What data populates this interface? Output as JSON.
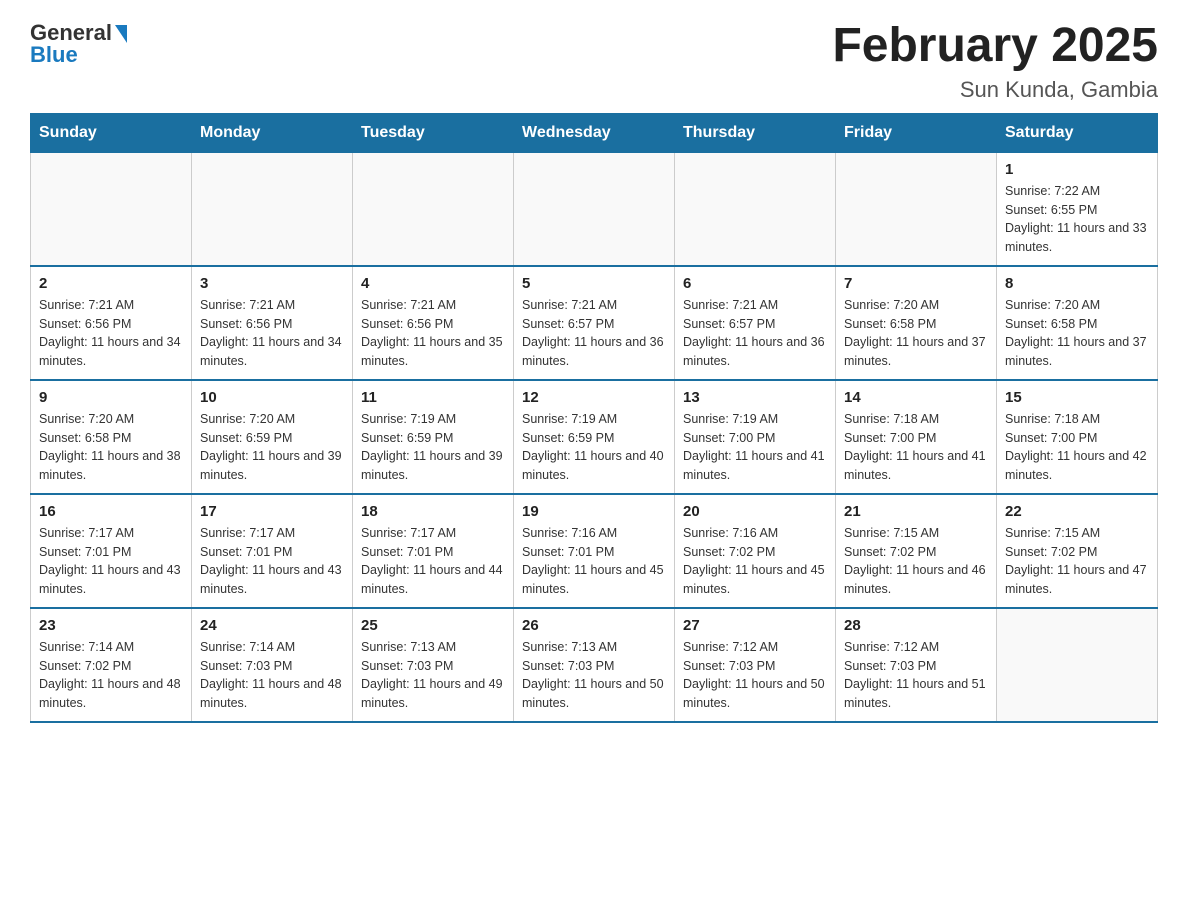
{
  "logo": {
    "general": "General",
    "blue": "Blue"
  },
  "title": "February 2025",
  "location": "Sun Kunda, Gambia",
  "weekdays": [
    "Sunday",
    "Monday",
    "Tuesday",
    "Wednesday",
    "Thursday",
    "Friday",
    "Saturday"
  ],
  "weeks": [
    [
      {
        "day": "",
        "info": ""
      },
      {
        "day": "",
        "info": ""
      },
      {
        "day": "",
        "info": ""
      },
      {
        "day": "",
        "info": ""
      },
      {
        "day": "",
        "info": ""
      },
      {
        "day": "",
        "info": ""
      },
      {
        "day": "1",
        "info": "Sunrise: 7:22 AM\nSunset: 6:55 PM\nDaylight: 11 hours and 33 minutes."
      }
    ],
    [
      {
        "day": "2",
        "info": "Sunrise: 7:21 AM\nSunset: 6:56 PM\nDaylight: 11 hours and 34 minutes."
      },
      {
        "day": "3",
        "info": "Sunrise: 7:21 AM\nSunset: 6:56 PM\nDaylight: 11 hours and 34 minutes."
      },
      {
        "day": "4",
        "info": "Sunrise: 7:21 AM\nSunset: 6:56 PM\nDaylight: 11 hours and 35 minutes."
      },
      {
        "day": "5",
        "info": "Sunrise: 7:21 AM\nSunset: 6:57 PM\nDaylight: 11 hours and 36 minutes."
      },
      {
        "day": "6",
        "info": "Sunrise: 7:21 AM\nSunset: 6:57 PM\nDaylight: 11 hours and 36 minutes."
      },
      {
        "day": "7",
        "info": "Sunrise: 7:20 AM\nSunset: 6:58 PM\nDaylight: 11 hours and 37 minutes."
      },
      {
        "day": "8",
        "info": "Sunrise: 7:20 AM\nSunset: 6:58 PM\nDaylight: 11 hours and 37 minutes."
      }
    ],
    [
      {
        "day": "9",
        "info": "Sunrise: 7:20 AM\nSunset: 6:58 PM\nDaylight: 11 hours and 38 minutes."
      },
      {
        "day": "10",
        "info": "Sunrise: 7:20 AM\nSunset: 6:59 PM\nDaylight: 11 hours and 39 minutes."
      },
      {
        "day": "11",
        "info": "Sunrise: 7:19 AM\nSunset: 6:59 PM\nDaylight: 11 hours and 39 minutes."
      },
      {
        "day": "12",
        "info": "Sunrise: 7:19 AM\nSunset: 6:59 PM\nDaylight: 11 hours and 40 minutes."
      },
      {
        "day": "13",
        "info": "Sunrise: 7:19 AM\nSunset: 7:00 PM\nDaylight: 11 hours and 41 minutes."
      },
      {
        "day": "14",
        "info": "Sunrise: 7:18 AM\nSunset: 7:00 PM\nDaylight: 11 hours and 41 minutes."
      },
      {
        "day": "15",
        "info": "Sunrise: 7:18 AM\nSunset: 7:00 PM\nDaylight: 11 hours and 42 minutes."
      }
    ],
    [
      {
        "day": "16",
        "info": "Sunrise: 7:17 AM\nSunset: 7:01 PM\nDaylight: 11 hours and 43 minutes."
      },
      {
        "day": "17",
        "info": "Sunrise: 7:17 AM\nSunset: 7:01 PM\nDaylight: 11 hours and 43 minutes."
      },
      {
        "day": "18",
        "info": "Sunrise: 7:17 AM\nSunset: 7:01 PM\nDaylight: 11 hours and 44 minutes."
      },
      {
        "day": "19",
        "info": "Sunrise: 7:16 AM\nSunset: 7:01 PM\nDaylight: 11 hours and 45 minutes."
      },
      {
        "day": "20",
        "info": "Sunrise: 7:16 AM\nSunset: 7:02 PM\nDaylight: 11 hours and 45 minutes."
      },
      {
        "day": "21",
        "info": "Sunrise: 7:15 AM\nSunset: 7:02 PM\nDaylight: 11 hours and 46 minutes."
      },
      {
        "day": "22",
        "info": "Sunrise: 7:15 AM\nSunset: 7:02 PM\nDaylight: 11 hours and 47 minutes."
      }
    ],
    [
      {
        "day": "23",
        "info": "Sunrise: 7:14 AM\nSunset: 7:02 PM\nDaylight: 11 hours and 48 minutes."
      },
      {
        "day": "24",
        "info": "Sunrise: 7:14 AM\nSunset: 7:03 PM\nDaylight: 11 hours and 48 minutes."
      },
      {
        "day": "25",
        "info": "Sunrise: 7:13 AM\nSunset: 7:03 PM\nDaylight: 11 hours and 49 minutes."
      },
      {
        "day": "26",
        "info": "Sunrise: 7:13 AM\nSunset: 7:03 PM\nDaylight: 11 hours and 50 minutes."
      },
      {
        "day": "27",
        "info": "Sunrise: 7:12 AM\nSunset: 7:03 PM\nDaylight: 11 hours and 50 minutes."
      },
      {
        "day": "28",
        "info": "Sunrise: 7:12 AM\nSunset: 7:03 PM\nDaylight: 11 hours and 51 minutes."
      },
      {
        "day": "",
        "info": ""
      }
    ]
  ]
}
